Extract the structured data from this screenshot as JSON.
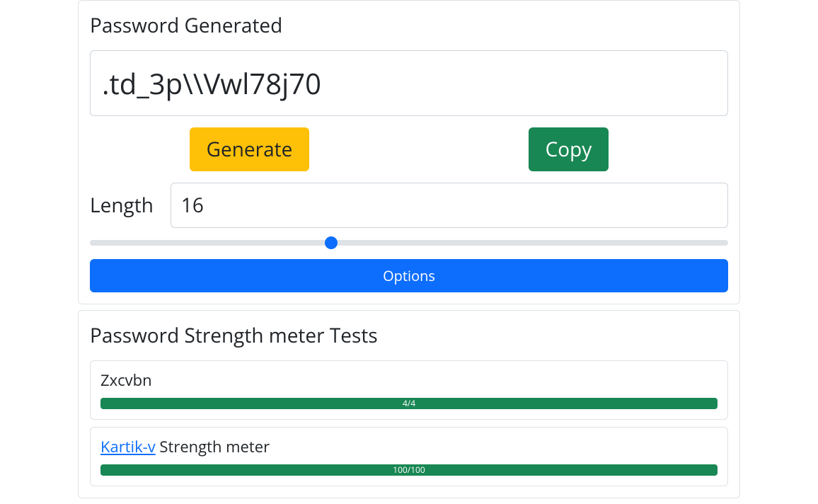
{
  "generator": {
    "title": "Password Generated",
    "password": ".td_3p\\\\Vwl78j70",
    "generate_label": "Generate",
    "copy_label": "Copy",
    "length_label": "Length",
    "length_value": "16",
    "slider_min": "4",
    "slider_max": "36",
    "slider_value": "16",
    "options_label": "Options"
  },
  "strength": {
    "title": "Password Strength meter Tests",
    "tests": [
      {
        "name": "Zxcvbn",
        "score_label": "4/4",
        "percent": "100"
      },
      {
        "link_text": "Kartik-v",
        "name_suffix": " Strength meter",
        "score_label": "100/100",
        "percent": "100"
      }
    ]
  }
}
